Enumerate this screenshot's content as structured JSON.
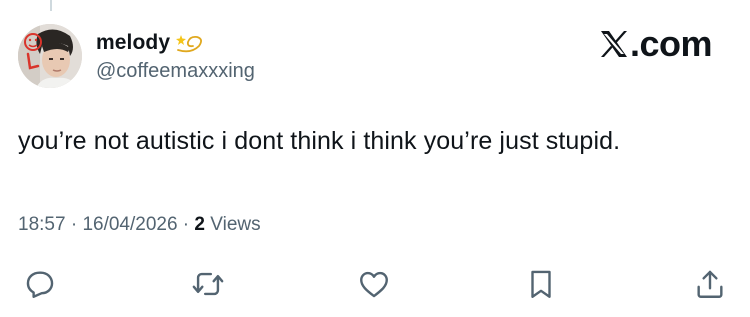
{
  "user": {
    "display_name": "melody",
    "handle": "@coffeemaxxxing",
    "badge_icon": "dizzy-icon"
  },
  "brand": {
    "label": ".com",
    "logo_icon": "x-logo-icon"
  },
  "tweet": {
    "text": "you’re not autistic i dont think i think you’re just stupid."
  },
  "meta": {
    "time": "18:57",
    "separator_1": " · ",
    "date": "16/04/2026",
    "separator_2": " · ",
    "views_count": "2",
    "views_label": " Views"
  },
  "actions": [
    "reply-icon",
    "retweet-icon",
    "like-icon",
    "bookmark-icon",
    "share-icon"
  ],
  "colors": {
    "text_primary": "#0f1419",
    "text_secondary": "#536471",
    "icon": "#536471"
  }
}
